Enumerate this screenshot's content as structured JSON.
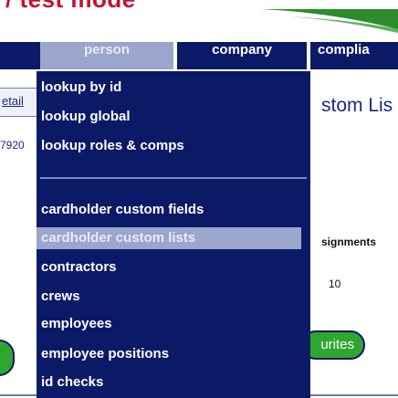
{
  "banner": {
    "mode_text": "/ test mode",
    "colors": {
      "mode_text": "#c8102e",
      "swoosh": "#2e8b2e"
    }
  },
  "nav": {
    "tabs": [
      {
        "label": "person",
        "active": true
      },
      {
        "label": "company",
        "active": false
      },
      {
        "label": "complia",
        "active": false
      }
    ],
    "colors": {
      "bar": "#0b1a66",
      "active": "#9aa6cc"
    }
  },
  "menu": {
    "items": [
      {
        "label": "lookup by id",
        "highlighted": false
      },
      {
        "label": "lookup global",
        "highlighted": false
      },
      {
        "label": "lookup roles & comps",
        "highlighted": false
      },
      {
        "label": "cardholder custom fields",
        "highlighted": false
      },
      {
        "label": "cardholder custom lists",
        "highlighted": true
      },
      {
        "label": "contractors",
        "highlighted": false
      },
      {
        "label": "crews",
        "highlighted": false
      },
      {
        "label": "employees",
        "highlighted": false
      },
      {
        "label": "employee positions",
        "highlighted": false
      },
      {
        "label": "id checks",
        "highlighted": false
      }
    ]
  },
  "background": {
    "left_tab_label": "etail",
    "id_fragment": "7920",
    "page_title_fragment": "stom Lis",
    "column_header_fragment": "signments",
    "column_value": "10",
    "favourites_fragment": "urites"
  }
}
